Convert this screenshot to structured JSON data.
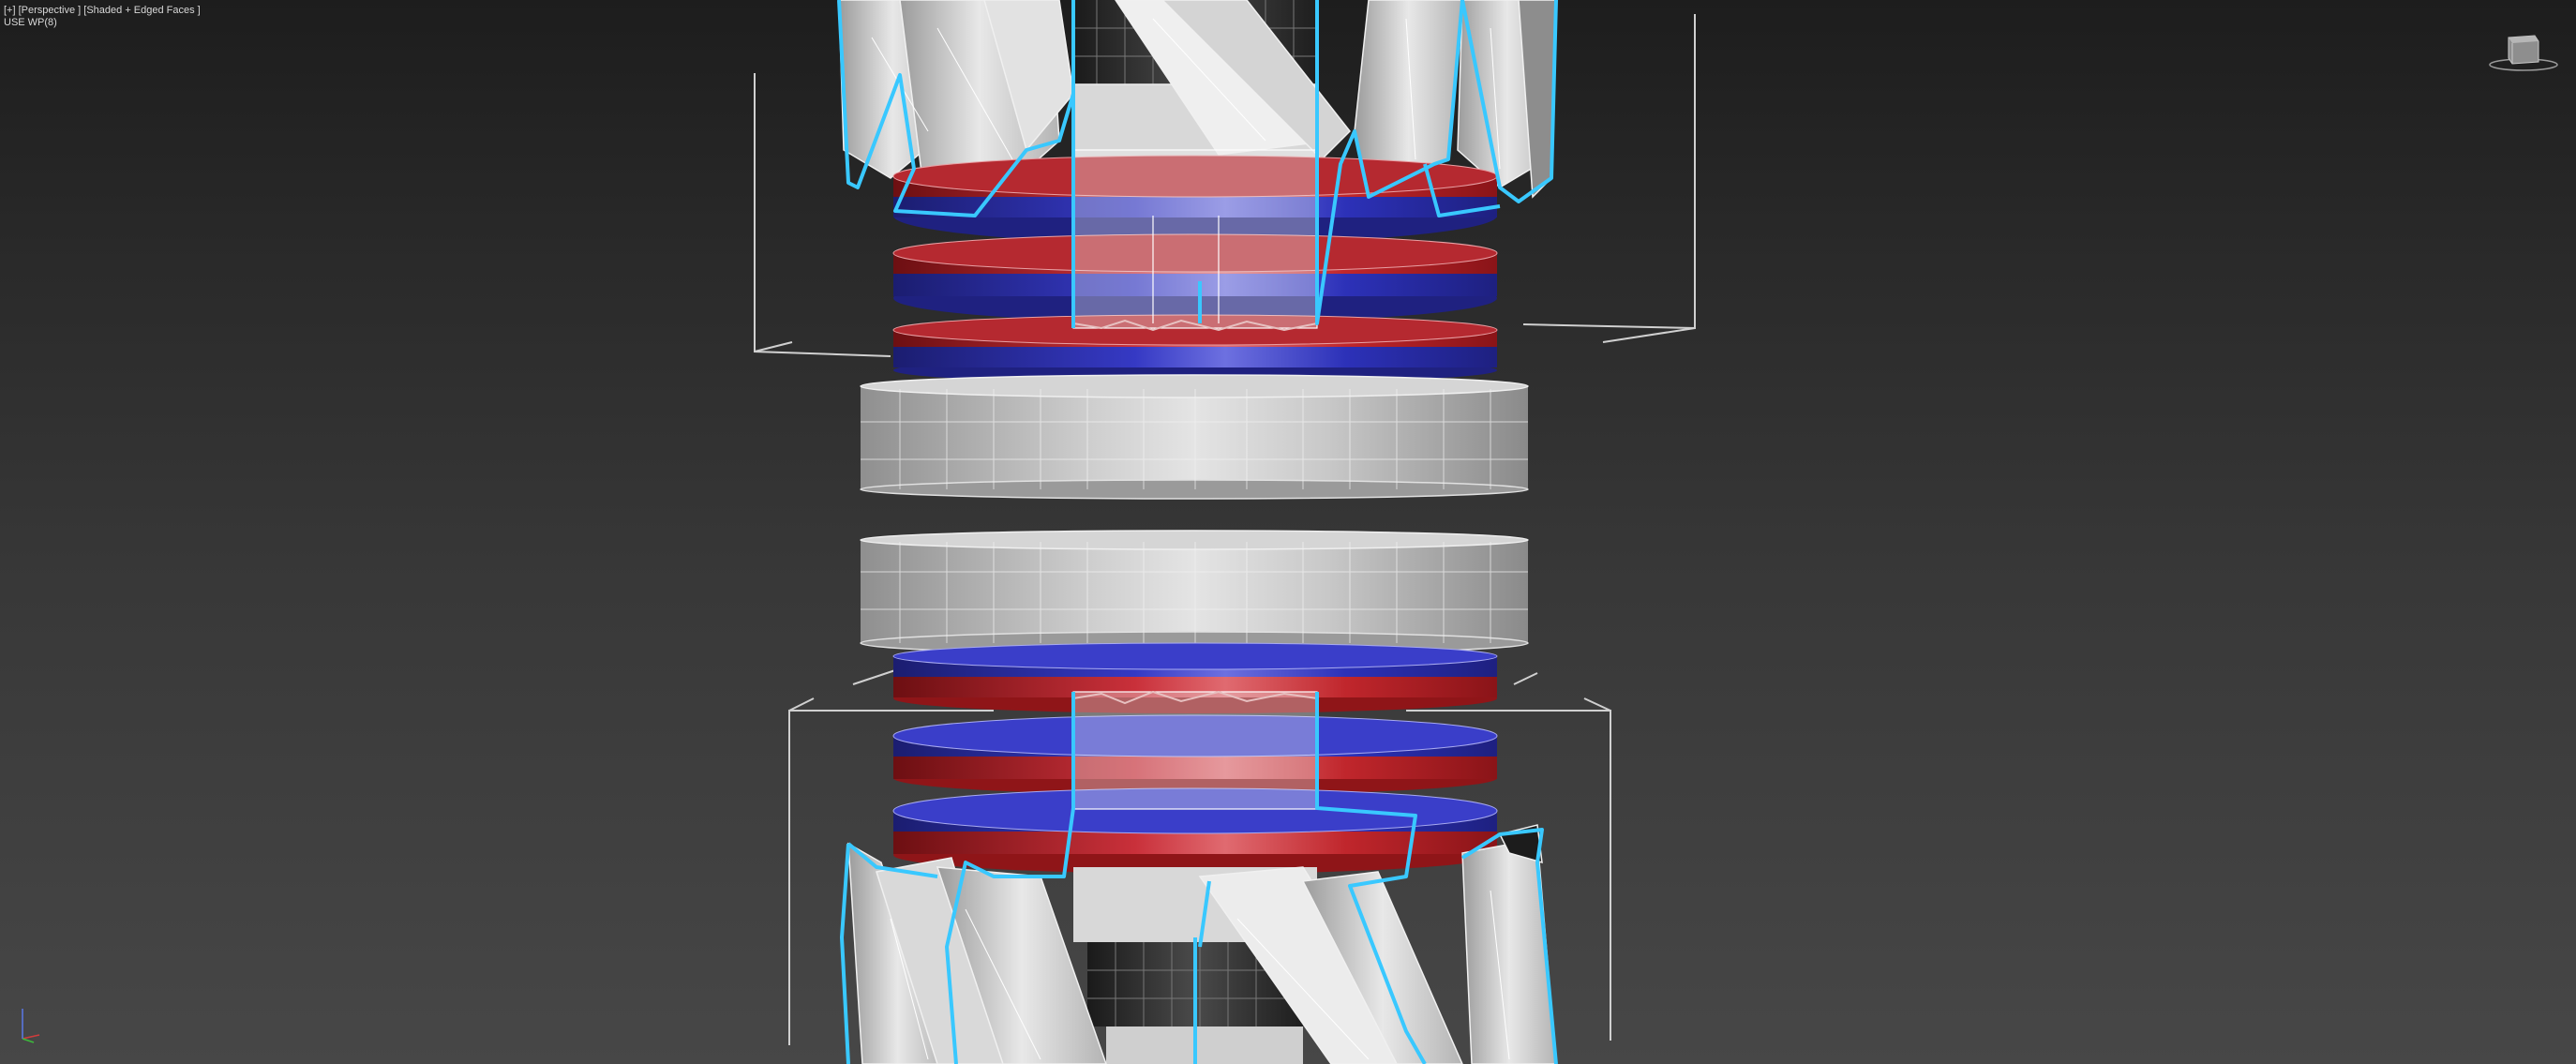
{
  "viewport": {
    "menu_label": "[+] [Perspective ] [Shaded + Edged Faces ]",
    "status_label": "USE WP(8)"
  },
  "icons": {
    "viewcube": "viewcube-icon",
    "axis_gizmo": "axis-tripod-icon"
  },
  "colors": {
    "background_top": "#1d1d1d",
    "background_bottom": "#474747",
    "selection_highlight": "#32c8ff",
    "magnet_red": "#c2262b",
    "magnet_blue": "#2a2fb8",
    "shell_gray": "#c9c9c9",
    "wire_white": "#e6e6e6"
  }
}
